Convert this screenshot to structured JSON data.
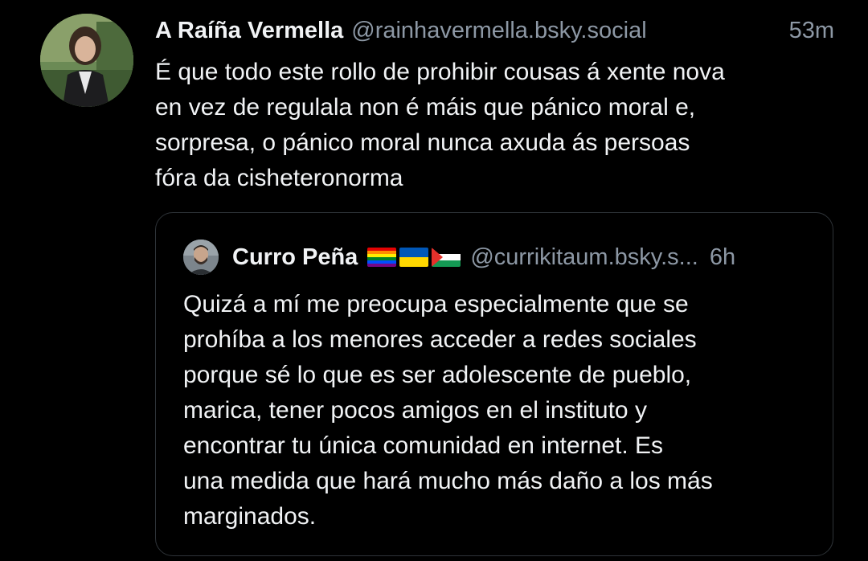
{
  "post": {
    "author": {
      "display_name": "A Raíña Vermella",
      "handle": "@rainhavermella.bsky.social",
      "avatar_icon": "user-avatar"
    },
    "time": "53m",
    "text": "É que todo este rollo de prohibir cousas á xente nova\nen vez de regulala non é máis que pánico moral e,\nsorpresa, o pánico moral nunca axuda ás persoas\nfóra da cisheteronorma"
  },
  "quote": {
    "author": {
      "display_name": "Curro Peña",
      "flags": [
        "rainbow-pride-flag",
        "ukraine-flag",
        "palestine-flag"
      ],
      "handle": "@currikitaum.bsky.s...",
      "avatar_icon": "user-avatar"
    },
    "time": "6h",
    "text": "Quizá a mí me preocupa especialmente que se\nprohíba a los menores acceder a redes sociales\nporque sé lo que es ser adolescente de pueblo,\nmarica, tener pocos amigos en el instituto y\nencontrar tu única comunidad en internet. Es\nuna medida que hará mucho más daño a los más\nmarginados."
  },
  "colors": {
    "background": "#000000",
    "text_primary": "#f1f3f5",
    "text_secondary": "#8d98a5",
    "quote_border": "#2e3338"
  }
}
